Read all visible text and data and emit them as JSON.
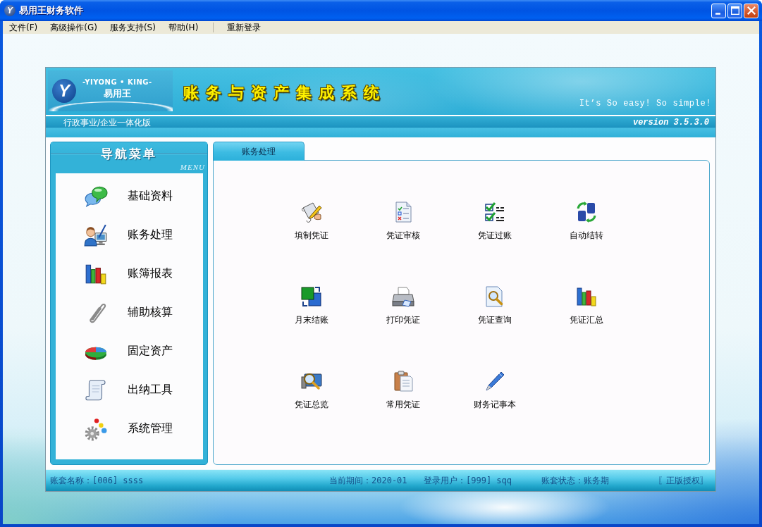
{
  "window": {
    "logo_mark": "Y",
    "title": "易用王财务软件"
  },
  "menu_bar": {
    "menus": [
      "文件(F)",
      "高级操作(G)",
      "服务支持(S)",
      "帮助(H)"
    ],
    "commands": [
      "重新登录"
    ]
  },
  "banner": {
    "logo": {
      "mark": "Y",
      "tagline": "-YIYONG • KING-",
      "name": "易用王"
    },
    "title": "账务与资产集成系统",
    "slogan": "It’s So easy! So simple!",
    "edition": "行政事业/企业一体化版",
    "version": "version 3.5.3.0"
  },
  "sidebar": {
    "title": "导航菜单",
    "subtitle": "MENU",
    "items": [
      "基础资料",
      "账务处理",
      "账簿报表",
      "辅助核算",
      "固定资产",
      "出纳工具",
      "系统管理"
    ]
  },
  "tabs": [
    {
      "label": "账务处理",
      "selected": true
    }
  ],
  "functions": [
    "填制凭证",
    "凭证审核",
    "凭证过账",
    "自动结转",
    "月末结账",
    "打印凭证",
    "凭证查询",
    "凭证汇总",
    "凭证总览",
    "常用凭证",
    "财务记事本"
  ],
  "status_bar": {
    "account": "账套名称：[006] ssss",
    "period": "当前期间：2020-01",
    "user": "登录用户：[999] sqq",
    "state": "账套状态：账务期",
    "license": "〖正版授权〗"
  }
}
